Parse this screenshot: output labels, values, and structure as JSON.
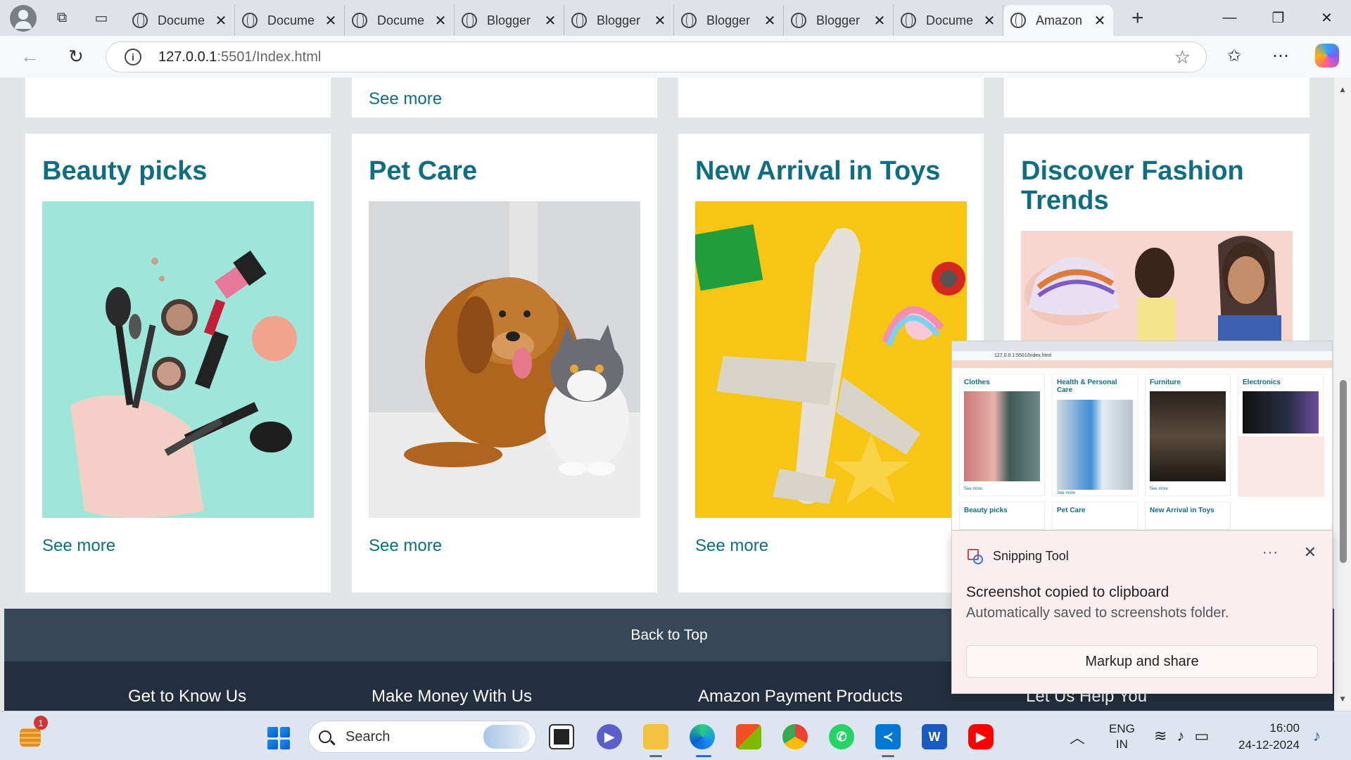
{
  "browser": {
    "tabs": [
      {
        "title": "Docume"
      },
      {
        "title": "Docume"
      },
      {
        "title": "Docume"
      },
      {
        "title": "Blogger"
      },
      {
        "title": "Blogger"
      },
      {
        "title": "Blogger"
      },
      {
        "title": "Blogger"
      },
      {
        "title": "Docume"
      },
      {
        "title": "Amazon",
        "active": true
      }
    ],
    "url_host": "127.0.0.1",
    "url_rest": ":5501/Index.html"
  },
  "page": {
    "top_row_see_more": "See more",
    "cards": [
      {
        "title": "Beauty picks",
        "see_more": "See more",
        "image": "makeup-photo"
      },
      {
        "title": "Pet Care",
        "see_more": "See more",
        "image": "dog-and-cat-photo"
      },
      {
        "title": "New Arrival in Toys",
        "see_more": "See more",
        "image": "toy-airplane-photo"
      },
      {
        "title": "Discover Fashion Trends",
        "image": "fashion-models-photo"
      }
    ],
    "back_to_top": "Back to Top",
    "footer_columns": [
      "Get to Know Us",
      "Make Money With Us",
      "Amazon Payment Products",
      "Let Us Help You"
    ]
  },
  "snip_preview": {
    "url": "127.0.0.1:5501/Index.html",
    "cards": [
      "Clothes",
      "Health & Personal Care",
      "Furniture",
      "Electronics"
    ],
    "cards_row2": [
      "Beauty picks",
      "Pet Care",
      "New Arrival in Toys"
    ],
    "see_more": "See more"
  },
  "toast": {
    "app_name": "Snipping Tool",
    "message": "Screenshot copied to clipboard",
    "submessage": "Automatically saved to screenshots folder.",
    "button": "Markup and share"
  },
  "taskbar": {
    "weather_badge": "1",
    "search_placeholder": "Search",
    "lang_line1": "ENG",
    "lang_line2": "IN",
    "time": "16:00",
    "date": "24-12-2024"
  },
  "colors": {
    "accent_teal": "#0e6f83",
    "backtop_bg": "#37475a",
    "footer_bg": "#232f3e"
  }
}
